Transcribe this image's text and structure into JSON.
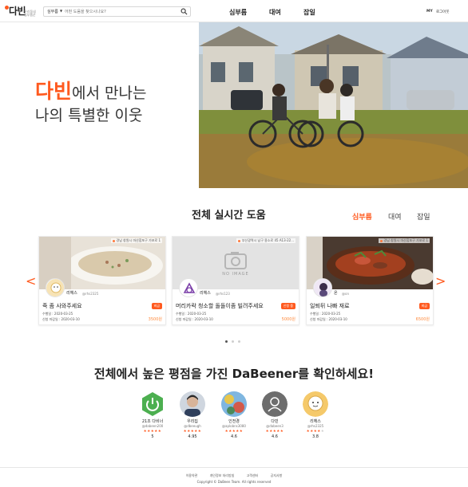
{
  "header": {
    "logo_text": "다빈",
    "logo_sub": "우리동네 심부름꾼",
    "search_category": "심부름",
    "search_placeholder": "어떤 도움을 찾으시나요?",
    "nav": [
      "심부름",
      "대여",
      "잡일"
    ],
    "my": "MY",
    "login": "로그아웃"
  },
  "hero": {
    "brand": "다빈",
    "line1_rest": "에서 만나는",
    "line2": "나의 특별한 이웃"
  },
  "realtime": {
    "title": "전체 실시간 도움",
    "tabs": [
      "심부름",
      "대여",
      "잡일"
    ],
    "prev": "<",
    "next": ">",
    "cards": [
      {
        "location": "경남 창원시 마산합포구 가포로 1",
        "user": "리헤스",
        "user_id": "@rhs2325",
        "title": "죽 좀 사와주세요",
        "badge": "비급",
        "line1": "수행일 : 2020-03-25",
        "line2": "신청 마감일 : 2020-03-10",
        "price": "3500원"
      },
      {
        "location": "부산광역시 남구 용소로 45 A13-22...",
        "no_image": "NO IMAGE",
        "user": "리헤스",
        "user_id": "@rhs123",
        "title": "머리카락 청소할 돌돌이좀 빌려주세요",
        "badge": "신청 중",
        "line1": "수행일 : 2020-03-25",
        "line2": "신청 마감일 : 2020-03-10",
        "price": "5000원"
      },
      {
        "location": "경남 창원시 마산합포구 가포로 1",
        "user": "온",
        "user_id": "@on",
        "title": "일퇴뒤 나빠 재료",
        "badge": "비급",
        "line1": "수행일 : 2020-03-25",
        "line2": "신청 마감일 : 2020-03-10",
        "price": "6500원"
      }
    ]
  },
  "rating": {
    "title": "전체에서 높은 평점을 가진 DaBeener를 확인하세요!",
    "users": [
      {
        "name": "21조 다비너",
        "id": "@dabeen200",
        "stars": 5,
        "score": "5",
        "color": "#4caf50"
      },
      {
        "name": "우리집",
        "id": "@dbeeugh",
        "stars": 5,
        "score": "4.95",
        "color": "#3a4a63"
      },
      {
        "name": "인전경",
        "id": "@aplobns3080",
        "stars": 5,
        "score": "4.6",
        "color": "#6aa9d9"
      },
      {
        "name": "다빈",
        "id": "@dabeen3",
        "stars": 5,
        "score": "4.6",
        "color": "#6d6d6d"
      },
      {
        "name": "리헤스",
        "id": "@rhs2325",
        "stars": 4,
        "score": "3.8",
        "color": "#f5c96a"
      }
    ]
  },
  "footer": {
    "links": [
      "이용약관",
      "개인정보 처리방침",
      "고객센터",
      "공지사항"
    ],
    "copyright": "Copyright © DaBeen Team. All rights reserved"
  },
  "colors": {
    "accent": "#ff5a1f",
    "price": "#ff8a3d",
    "star": "#ff5a1f"
  }
}
